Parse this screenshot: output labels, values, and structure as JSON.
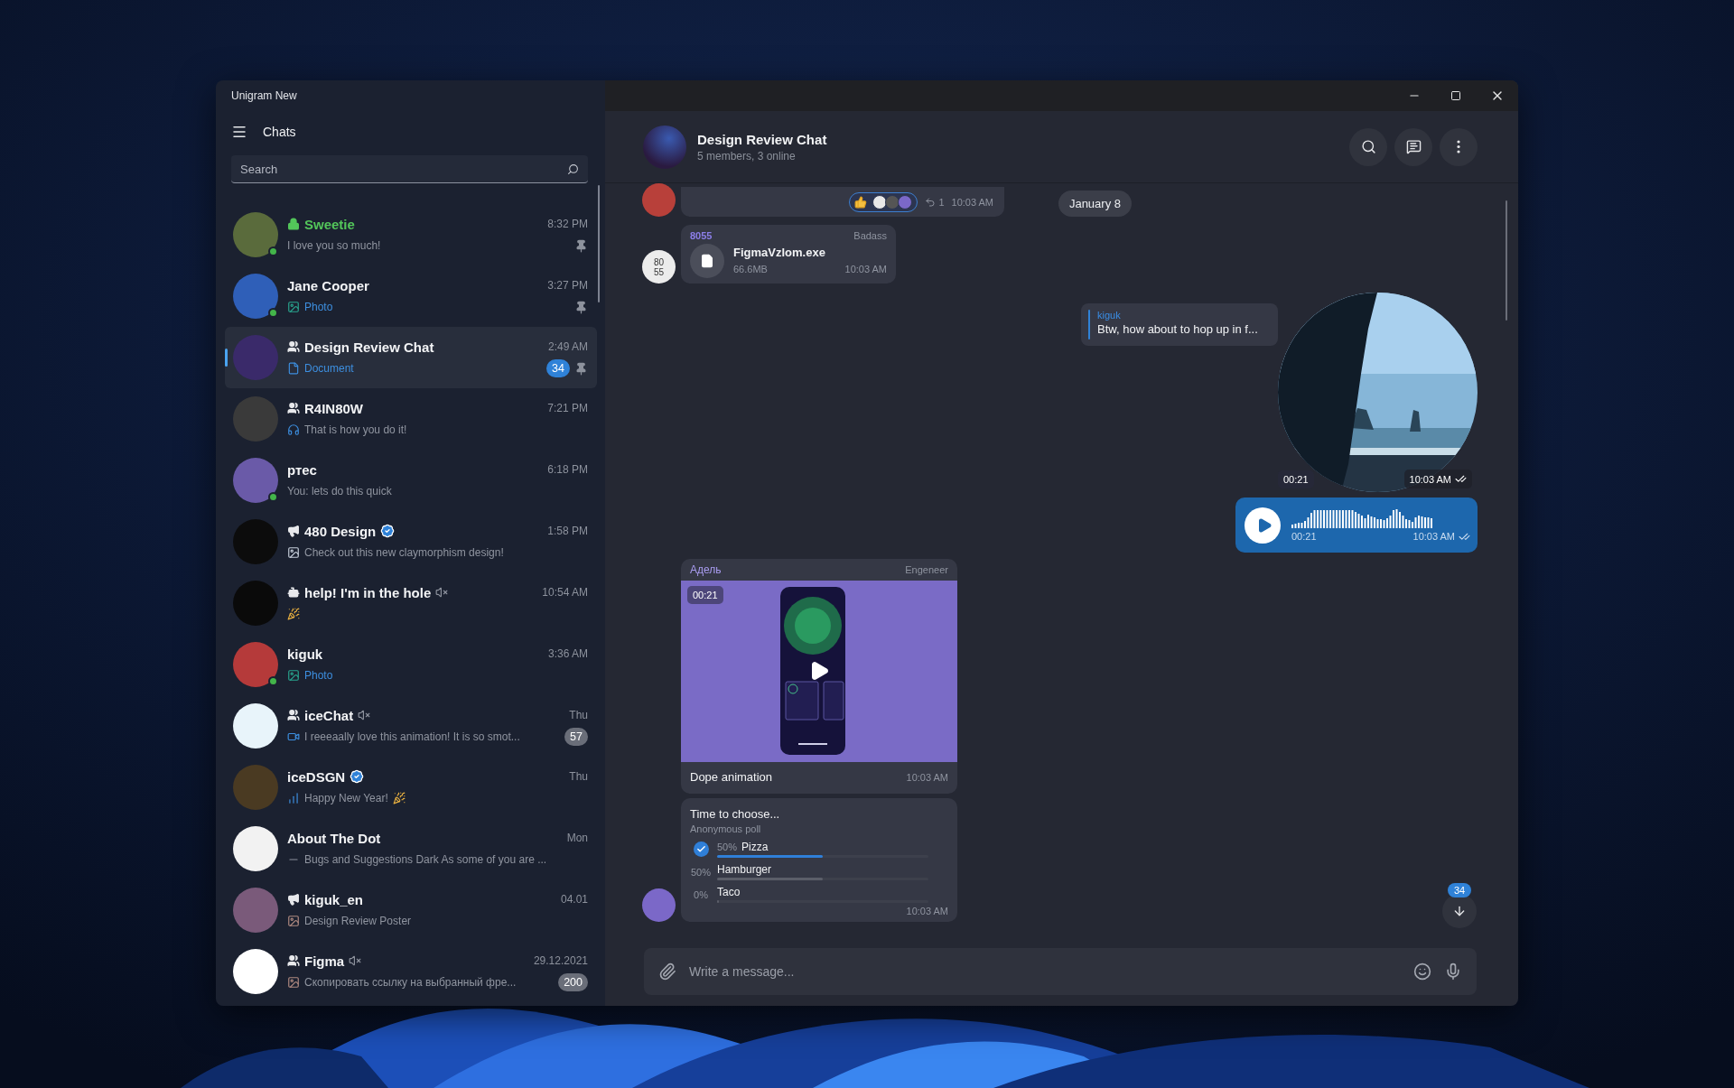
{
  "window": {
    "title": "Unigram New"
  },
  "sidebar": {
    "header": "Chats",
    "search": {
      "placeholder": "Search"
    },
    "chats": [
      {
        "name": "Sweetie",
        "kind": "secret",
        "verified": false,
        "muted": false,
        "preview": "I love you so much!",
        "time": "8:32 PM",
        "pinned": true,
        "online": true,
        "selected": false
      },
      {
        "name": "Jane Cooper",
        "kind": "private",
        "verified": false,
        "muted": false,
        "preview": "Photo",
        "media": true,
        "time": "3:27 PM",
        "pinned": true,
        "online": true,
        "selected": false
      },
      {
        "name": "Design Review Chat",
        "kind": "group",
        "verified": false,
        "muted": false,
        "attachment": {
          "kind": "document"
        },
        "preview": "Document",
        "media": true,
        "time": "2:49 AM",
        "unread": "34",
        "pinned": true,
        "online": false,
        "selected": true
      },
      {
        "name": "R4IN80W",
        "kind": "group",
        "verified": false,
        "muted": false,
        "attachment": {
          "kind": "headphones"
        },
        "preview": "That is how you do it!",
        "time": "7:21 PM",
        "pinned": false,
        "online": false,
        "selected": false
      },
      {
        "name": "ртес",
        "kind": "private",
        "verified": false,
        "muted": false,
        "preview": "You: lets do this quick",
        "time": "6:18 PM",
        "pinned": false,
        "online": true,
        "selected": false
      },
      {
        "name": "480 Design",
        "kind": "channel",
        "verified": true,
        "muted": false,
        "preview": "Check out this new claymorphism design!",
        "time": "1:58 PM",
        "pinned": false,
        "online": false,
        "selected": false
      },
      {
        "name": "help! I'm in the hole",
        "kind": "bot",
        "verified": false,
        "muted": true,
        "attachment": {
          "kind": "party"
        },
        "time": "10:54 AM",
        "pinned": false,
        "online": false,
        "selected": false
      },
      {
        "name": "kiguk",
        "kind": "private",
        "verified": false,
        "muted": false,
        "preview": "Photo",
        "media": true,
        "time": "3:36 AM",
        "pinned": false,
        "online": true,
        "selected": false
      },
      {
        "name": "iceChat",
        "kind": "group",
        "verified": false,
        "muted": true,
        "attachment": {
          "kind": "video"
        },
        "preview": "I reeeaally love this animation! It is so smot...",
        "time": "Thu",
        "unread": "57",
        "pinned": false,
        "online": false,
        "selected": false
      },
      {
        "name": "iceDSGN",
        "kind": "private",
        "verified": true,
        "muted": false,
        "attachment": {
          "kind": "chart"
        },
        "preview": "Happy New Year!",
        "trailing": {
          "kind": "party"
        },
        "time": "Thu",
        "pinned": false,
        "online": false,
        "selected": false
      },
      {
        "name": "About The Dot",
        "kind": "private",
        "verified": false,
        "muted": false,
        "attachment": {
          "kind": "line"
        },
        "preview": "Bugs and Suggestions Dark As some of you are ...",
        "time": "Mon",
        "pinned": false,
        "online": false,
        "selected": false
      },
      {
        "name": "kiguk_en",
        "kind": "channel",
        "verified": false,
        "muted": false,
        "attachment": {
          "kind": "thumbnail"
        },
        "preview": "Design Review Poster",
        "time": "04.01",
        "pinned": false,
        "online": false,
        "selected": false
      },
      {
        "name": "Figma",
        "kind": "group",
        "verified": false,
        "muted": true,
        "attachment": {
          "kind": "thumbnail"
        },
        "preview": "Скопировать ссылку на выбранный фре...",
        "time": "29.12.2021",
        "unread": "200",
        "pinned": false,
        "online": false,
        "selected": false
      }
    ]
  },
  "chat": {
    "title": "Design Review Chat",
    "subtitle": "5 members, 3 online",
    "incoming": [
      {
        "kind": "reactions",
        "reply_count": "1",
        "time": "10:03 AM"
      },
      {
        "kind": "file",
        "avatar": {
          "kind": "initials",
          "lines": [
            "80",
            "55"
          ]
        },
        "sender": "8055",
        "tag": "Badass",
        "file_name": "FigmaVzlom.exe",
        "size": "66.6MB",
        "time": "10:03 AM"
      },
      {
        "kind": "video",
        "sender": "Адель",
        "tag": "Engeneer",
        "duration": "00:21",
        "caption": "Dope animation",
        "time": "10:03 AM"
      },
      {
        "kind": "poll",
        "avatar": {
          "kind": "logo"
        },
        "question": "Time to choose...",
        "poll_type": "Anonymous poll",
        "options": [
          {
            "percent": "50%",
            "text": "Pizza",
            "level": 0.5,
            "selected": true
          },
          {
            "percent": "50%",
            "text": "Hamburger",
            "level": 0.5,
            "selected": false
          },
          {
            "percent": "0%",
            "text": "Taco",
            "level": 0,
            "selected": false
          }
        ],
        "time": "10:03 AM"
      }
    ],
    "date_divider": "January 8",
    "outgoing": [
      {
        "kind": "round_video",
        "reply": {
          "author": "kiguk",
          "text": "Btw, how about to hop up in f..."
        },
        "duration": "00:21",
        "time": "10:03 AM",
        "read": true
      },
      {
        "kind": "voice",
        "duration": "00:21",
        "time": "10:03 AM",
        "read": true
      }
    ],
    "scroll_down": {
      "unread": "34"
    },
    "composer": {
      "placeholder": "Write a message..."
    }
  }
}
